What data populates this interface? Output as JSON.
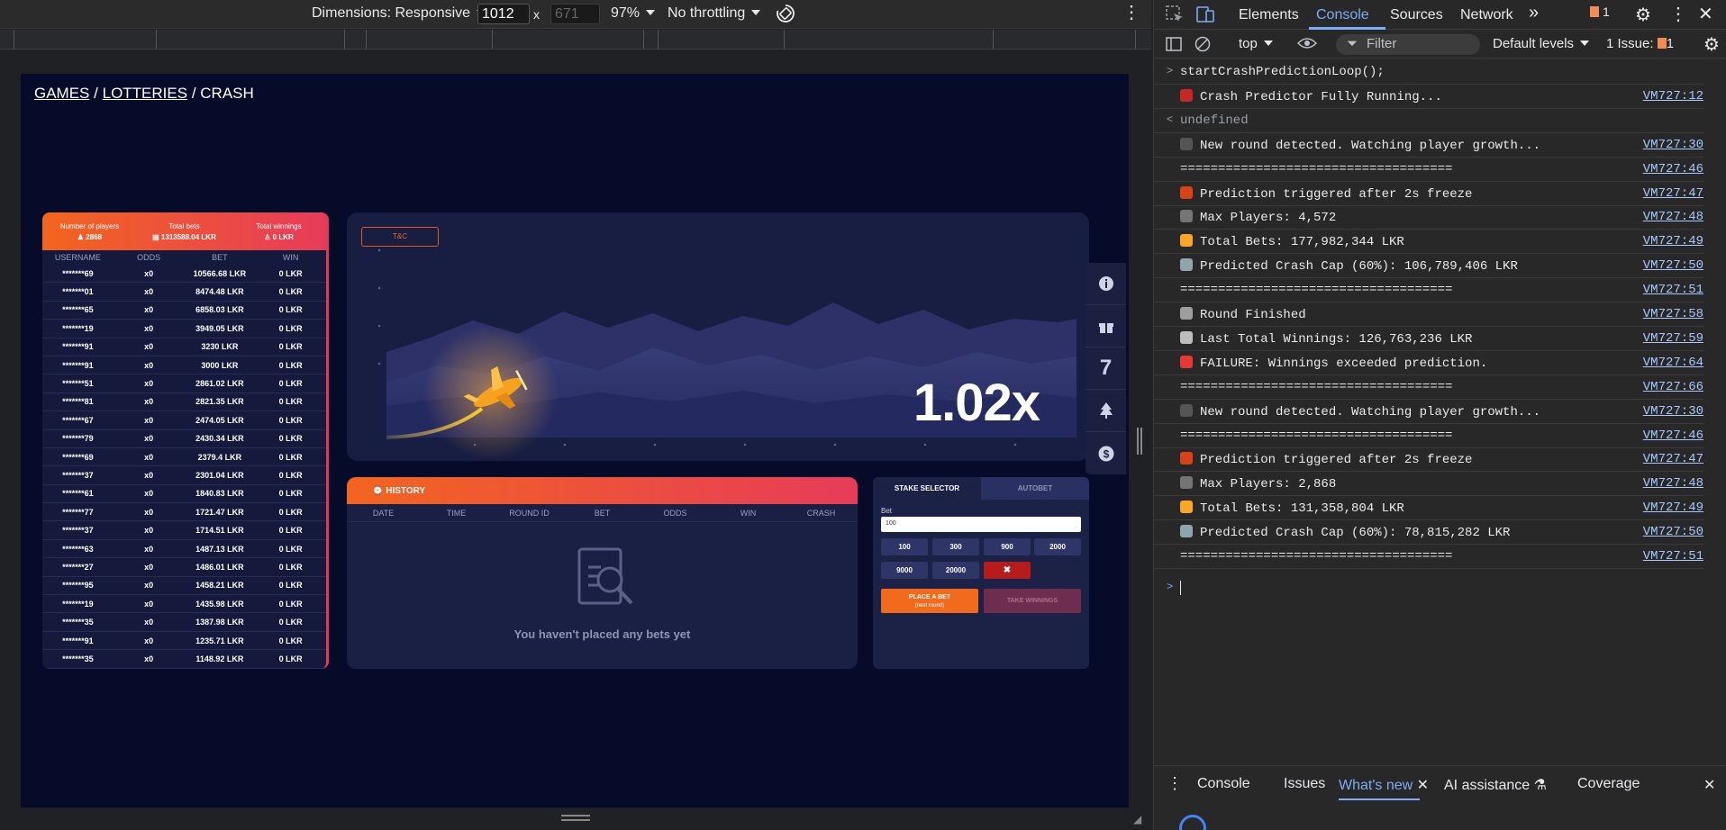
{
  "emu_toolbar": {
    "dimensions_label": "Dimensions: Responsive",
    "width": "1012",
    "times": "x",
    "height": "671",
    "zoom": "97%",
    "throttling": "No throttling"
  },
  "breadcrumb": {
    "games": "GAMES",
    "sep1": "/",
    "lotteries": "LOTTERIES",
    "sep2": "/",
    "crash": "CRASH"
  },
  "players": {
    "stats": [
      {
        "label": "Number of players",
        "value": "2868"
      },
      {
        "label": "Total bets",
        "value": "1313588.04 LKR"
      },
      {
        "label": "Total winnings",
        "value": "0 LKR"
      }
    ],
    "columns": [
      "USERNAME",
      "ODDS",
      "BET",
      "WIN"
    ],
    "rows": [
      [
        "*******69",
        "x0",
        "10566.68 LKR",
        "0 LKR"
      ],
      [
        "*******01",
        "x0",
        "8474.48 LKR",
        "0 LKR"
      ],
      [
        "*******65",
        "x0",
        "6858.03 LKR",
        "0 LKR"
      ],
      [
        "*******19",
        "x0",
        "3949.05 LKR",
        "0 LKR"
      ],
      [
        "*******91",
        "x0",
        "3230 LKR",
        "0 LKR"
      ],
      [
        "*******91",
        "x0",
        "3000 LKR",
        "0 LKR"
      ],
      [
        "*******51",
        "x0",
        "2861.02 LKR",
        "0 LKR"
      ],
      [
        "*******81",
        "x0",
        "2821.35 LKR",
        "0 LKR"
      ],
      [
        "*******67",
        "x0",
        "2474.05 LKR",
        "0 LKR"
      ],
      [
        "*******79",
        "x0",
        "2430.34 LKR",
        "0 LKR"
      ],
      [
        "*******69",
        "x0",
        "2379.4 LKR",
        "0 LKR"
      ],
      [
        "*******37",
        "x0",
        "2301.04 LKR",
        "0 LKR"
      ],
      [
        "*******61",
        "x0",
        "1840.83 LKR",
        "0 LKR"
      ],
      [
        "*******77",
        "x0",
        "1721.47 LKR",
        "0 LKR"
      ],
      [
        "*******37",
        "x0",
        "1714.51 LKR",
        "0 LKR"
      ],
      [
        "*******63",
        "x0",
        "1487.13 LKR",
        "0 LKR"
      ],
      [
        "*******27",
        "x0",
        "1486.01 LKR",
        "0 LKR"
      ],
      [
        "*******95",
        "x0",
        "1458.21 LKR",
        "0 LKR"
      ],
      [
        "*******19",
        "x0",
        "1435.98 LKR",
        "0 LKR"
      ],
      [
        "*******35",
        "x0",
        "1387.98 LKR",
        "0 LKR"
      ],
      [
        "*******91",
        "x0",
        "1235.71 LKR",
        "0 LKR"
      ],
      [
        "*******35",
        "x0",
        "1148.92 LKR",
        "0 LKR"
      ]
    ]
  },
  "graph": {
    "tc": "T&C",
    "multiplier": "1.02x"
  },
  "side_icons": {
    "seven": "7"
  },
  "history": {
    "title": "HISTORY",
    "columns": [
      "DATE",
      "TIME",
      "ROUND ID",
      "BET",
      "ODDS",
      "WIN",
      "CRASH"
    ],
    "empty": "You haven't placed any bets yet"
  },
  "stake": {
    "tab_stake": "STAKE SELECTOR",
    "tab_autobet": "AUTOBET",
    "bet_label": "Bet",
    "bet_value": "100",
    "chips": [
      "100",
      "300",
      "900",
      "2000",
      "9000",
      "20000"
    ],
    "clear": "✖",
    "place_bet": "PLACE A BET",
    "place_bet_sub": "(next round)",
    "take_winnings": "TAKE WINNINGS"
  },
  "devtools": {
    "tabs": [
      "Elements",
      "Console",
      "Sources",
      "Network"
    ],
    "more": "»",
    "issue_count": "1",
    "context": "top",
    "filter_placeholder": "Filter",
    "levels": "Default levels",
    "issues_label": "1 Issue:",
    "issues_count": "1",
    "console": [
      {
        "pre": ">",
        "msg": "startCrashPredictionLoop();",
        "src": ""
      },
      {
        "icon": "rocket",
        "color": "#c62828",
        "msg": "Crash Predictor Fully Running...",
        "src": "VM727:12"
      },
      {
        "pre": "<",
        "msg": "undefined",
        "src": "",
        "dim": true
      },
      {
        "icon": "clapper",
        "color": "#555",
        "msg": "New round detected. Watching player growth...",
        "src": "VM727:30"
      },
      {
        "msg": "====================================",
        "src": "VM727:46"
      },
      {
        "icon": "target",
        "color": "#d84315",
        "msg": "Prediction triggered after 2s freeze",
        "src": "VM727:47"
      },
      {
        "icon": "people",
        "color": "#757575",
        "msg": "Max Players: 4,572",
        "src": "VM727:48"
      },
      {
        "icon": "moneybag",
        "color": "#f9a825",
        "msg": "Total Bets: 177,982,344 LKR",
        "src": "VM727:49"
      },
      {
        "icon": "chart",
        "color": "#90a4ae",
        "msg": "Predicted Crash Cap (60%): 106,789,406 LKR",
        "src": "VM727:50"
      },
      {
        "msg": "====================================",
        "src": "VM727:51"
      },
      {
        "icon": "flag",
        "color": "#9e9e9e",
        "msg": "Round Finished",
        "src": "VM727:58"
      },
      {
        "icon": "receipt",
        "color": "#bdbdbd",
        "msg": "Last Total Winnings: 126,763,236 LKR",
        "src": "VM727:59"
      },
      {
        "icon": "cross",
        "color": "#e53935",
        "msg": "FAILURE: Winnings exceeded prediction.",
        "src": "VM727:64"
      },
      {
        "msg": "====================================",
        "src": "VM727:66"
      },
      {
        "icon": "clapper",
        "color": "#555",
        "msg": "New round detected. Watching player growth...",
        "src": "VM727:30"
      },
      {
        "msg": "====================================",
        "src": "VM727:46"
      },
      {
        "icon": "target",
        "color": "#d84315",
        "msg": "Prediction triggered after 2s freeze",
        "src": "VM727:47"
      },
      {
        "icon": "people",
        "color": "#757575",
        "msg": "Max Players: 2,868",
        "src": "VM727:48"
      },
      {
        "icon": "moneybag",
        "color": "#f9a825",
        "msg": "Total Bets: 131,358,804 LKR",
        "src": "VM727:49"
      },
      {
        "icon": "chart",
        "color": "#90a4ae",
        "msg": "Predicted Crash Cap (60%): 78,815,282 LKR",
        "src": "VM727:50"
      },
      {
        "msg": "====================================",
        "src": "VM727:51"
      }
    ],
    "drawer_tabs": [
      "Console",
      "Issues",
      "What's new",
      "AI assistance",
      "Coverage"
    ]
  }
}
